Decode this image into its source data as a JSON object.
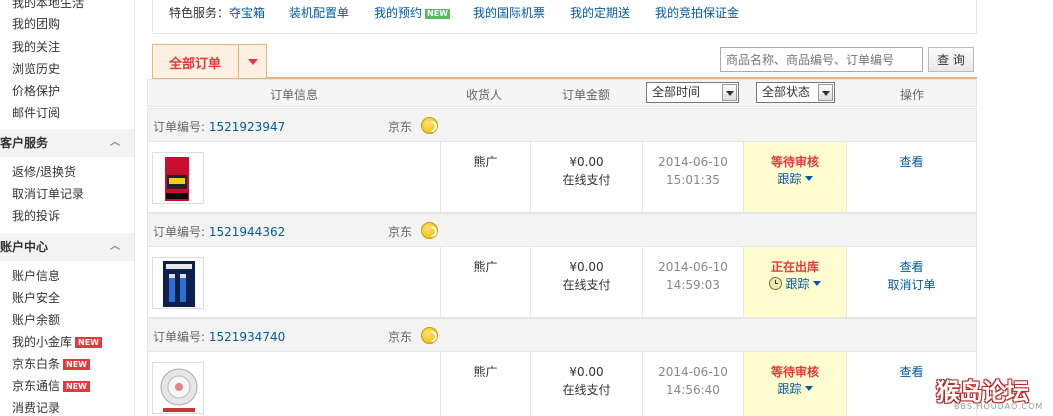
{
  "sidebar": {
    "top_items": [
      "我的本地生活",
      "我的团购",
      "我的关注",
      "浏览历史",
      "价格保护",
      "邮件订阅"
    ],
    "sections": [
      {
        "title": "客户服务",
        "items": [
          {
            "label": "返修/退换货"
          },
          {
            "label": "取消订单记录"
          },
          {
            "label": "我的投诉"
          }
        ]
      },
      {
        "title": "账户中心",
        "items": [
          {
            "label": "账户信息"
          },
          {
            "label": "账户安全"
          },
          {
            "label": "账户余额"
          },
          {
            "label": "我的小金库",
            "badge": "NEW"
          },
          {
            "label": "京东白条",
            "badge": "NEW"
          },
          {
            "label": "京东通信",
            "badge": "NEW"
          },
          {
            "label": "消费记录"
          }
        ]
      }
    ]
  },
  "services": {
    "label": "特色服务：",
    "links": [
      {
        "label": "夺宝箱"
      },
      {
        "label": "装机配置单"
      },
      {
        "label": "我的预约",
        "badge": "NEW"
      },
      {
        "label": "我的国际机票"
      },
      {
        "label": "我的定期送"
      },
      {
        "label": "我的竞拍保证金"
      }
    ]
  },
  "tabs": {
    "all_orders": "全部订单"
  },
  "search": {
    "placeholder": "商品名称、商品编号、订单编号",
    "button": "查 询"
  },
  "table": {
    "headers": {
      "info": "订单信息",
      "receiver": "收货人",
      "amount": "订单金额",
      "time_filter": "全部时间",
      "status_filter": "全部状态",
      "action": "操作"
    },
    "order_no_label": "订单编号:",
    "orders": [
      {
        "no": "1521923947",
        "shop": "京东",
        "receiver": "熊广",
        "amount": "¥0.00",
        "pay": "在线支付",
        "date": "2014-06-10",
        "time": "15:01:35",
        "status": "等待审核",
        "track": "跟踪",
        "actions": [
          "查看"
        ],
        "status_color": "#e4393c"
      },
      {
        "no": "1521944362",
        "shop": "京东",
        "receiver": "熊广",
        "amount": "¥0.00",
        "pay": "在线支付",
        "date": "2014-06-10",
        "time": "14:59:03",
        "status": "正在出库",
        "track": "跟踪",
        "actions": [
          "查看",
          "取消订单"
        ],
        "status_color": "#e4393c"
      },
      {
        "no": "1521934740",
        "shop": "京东",
        "receiver": "熊广",
        "amount": "¥0.00",
        "pay": "在线支付",
        "date": "2014-06-10",
        "time": "14:56:40",
        "status": "等待审核",
        "track": "跟踪",
        "actions": [
          "查看"
        ],
        "status_color": "#e4393c"
      }
    ]
  },
  "watermark": {
    "main": "猴岛论坛",
    "sub": "BBS.HOUDAO.COM"
  }
}
